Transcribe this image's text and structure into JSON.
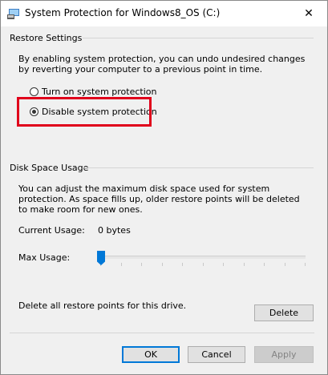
{
  "window": {
    "title": "System Protection for Windows8_OS (C:)",
    "icon": "system-protection-icon",
    "close_glyph": "✕"
  },
  "restore_settings": {
    "group_label": "Restore Settings",
    "description": "By enabling system protection, you can undo undesired changes by reverting your computer to a previous point in time.",
    "options": [
      {
        "label": "Turn on system protection",
        "checked": false
      },
      {
        "label": "Disable system protection",
        "checked": true
      }
    ],
    "highlight_color": "#e0001b"
  },
  "disk_space": {
    "group_label": "Disk Space Usage",
    "description": "You can adjust the maximum disk space used for system protection. As space fills up, older restore points will be deleted to make room for new ones.",
    "current_usage_label": "Current Usage:",
    "current_usage_value": "0 bytes",
    "max_usage_label": "Max Usage:",
    "max_usage_slider_fraction": 0,
    "delete_text": "Delete all restore points for this drive.",
    "delete_button": "Delete"
  },
  "footer": {
    "ok": "OK",
    "cancel": "Cancel",
    "apply": "Apply",
    "apply_enabled": false
  },
  "colors": {
    "accent": "#0078d7",
    "dialog_bg": "#f0f0f0"
  }
}
